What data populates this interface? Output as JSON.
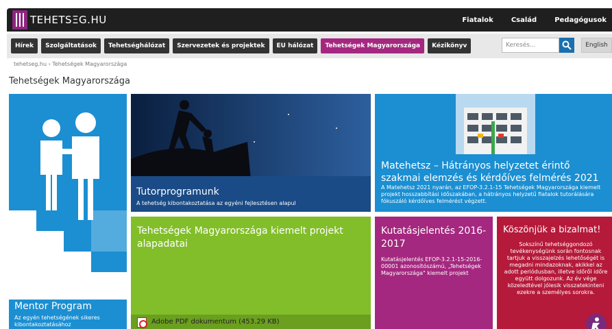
{
  "header": {
    "logo_text": "TEHETSΞG.HU",
    "top_links": [
      "Fiatalok",
      "Család",
      "Pedagógusok"
    ]
  },
  "nav": {
    "items": [
      "Hírek",
      "Szolgáltatások",
      "Tehetséghálózat",
      "Szervezetek és projektek",
      "EU hálózat",
      "Tehetségek Magyarországa",
      "Kézikönyv"
    ],
    "active_index": 5,
    "search_placeholder": "Keresés...",
    "lang_label": "English"
  },
  "breadcrumb": "tehetseg.hu › Tehetségek Magyarországa",
  "page_title": "Tehetségek Magyarországa",
  "tiles": {
    "mentor": {
      "title": "Mentor Program",
      "subtitle": "Az egyén tehetségének sikeres kibontakoztatásához"
    },
    "tutor": {
      "title": "Tutorprogramunk",
      "subtitle": "A tehetség kibontakoztatása az egyéni fejlesztésen alapul"
    },
    "matehetsz": {
      "title": "Matehetsz – Hátrányos helyzetet érintő szakmai elemzés és kérdőíves felmérés 2021",
      "subtitle": "A Matehetsz 2021 nyarán, az EFOP-3.2.1-15 Tehetségek Magyarországa kiemelt projekt hosszabbítási időszakában, a hátrányos helyzetű fiatalok tutorálására fókuszáló kérdőíves felmérést végzett."
    },
    "project": {
      "title": "Tehetségek Magyarországa kiemelt projekt alapadatai",
      "file_label": "Adobe PDF dokumentum (453.29 KB)"
    },
    "report": {
      "title": "Kutatásjelentés 2016-2017",
      "subtitle": "Kutatásjelentés EFOP-3.2.1-15-2016-00001 azonosítószámú, „Tehetségek Magyarországa\" kiemelt projekt"
    },
    "thanks": {
      "title": "Köszönjük a bizalmat!",
      "subtitle": "Sokszínű tehetséggondozó tevékenységünk során fontosnak tartjuk a visszajelzés lehetőségét is megadni mindazoknak, akikkel az adott periódusban, illetve időről időre együtt dolgozunk. Az év vége közeledtével jólesik visszatekinteni ezekre a személyes sorokra."
    }
  },
  "colors": {
    "brand_purple": "#a4287f",
    "blue": "#1b8fd2",
    "green": "#82be2a",
    "crimson": "#b51a3a",
    "dark": "#1f1f1f"
  }
}
